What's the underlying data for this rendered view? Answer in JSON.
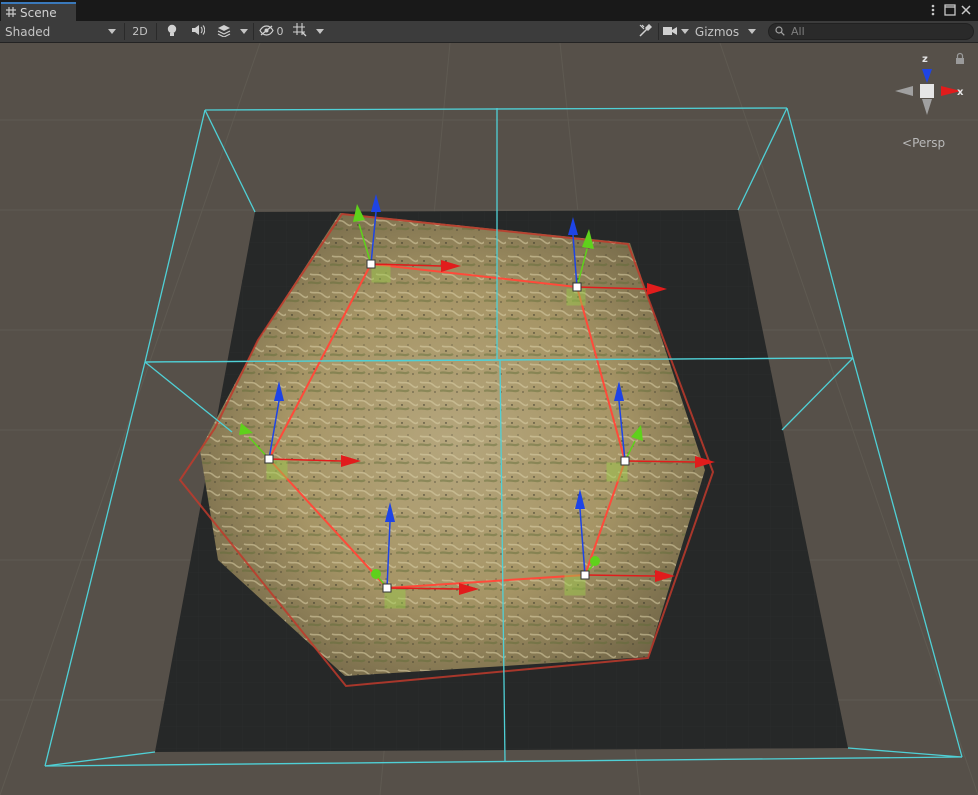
{
  "tab": {
    "title": "Scene"
  },
  "toolbar": {
    "shading_mode": "Shaded",
    "mode_2d": "2D",
    "hidden_count": "0",
    "gizmos": "Gizmos",
    "search_placeholder": "All"
  },
  "orientation": {
    "z_label": "z",
    "x_label": "x",
    "projection": "Persp"
  },
  "icons": {
    "tab": "scene-grid-icon",
    "lighting": "lightbulb-icon",
    "audio": "speaker-icon",
    "effects": "layers-icon",
    "visibility": "eye-slash-icon",
    "grid": "grid-snap-icon",
    "tools": "tools-icon",
    "camera": "camera-icon",
    "search": "search-icon",
    "lock": "lock-icon",
    "more": "kebab-menu-icon",
    "maximize": "maximize-icon",
    "close": "close-icon"
  },
  "colors": {
    "selection_outline": "#c0392b",
    "spline_path": "#ff4a3a",
    "bounds": "#4fd0d6",
    "axis_x": "#e11c1c",
    "axis_y": "#5fd11b",
    "axis_z": "#1e44e6"
  }
}
